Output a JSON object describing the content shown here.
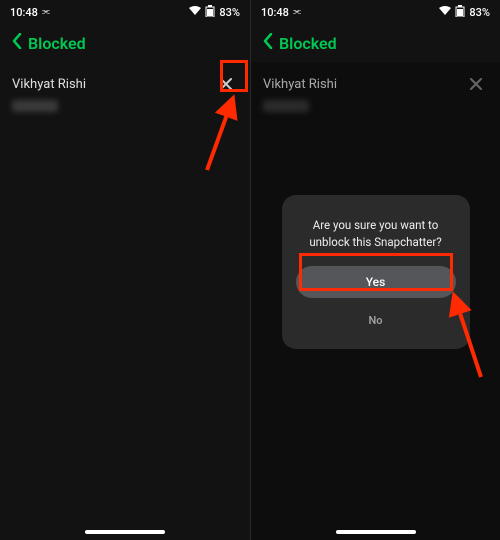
{
  "status": {
    "time": "10:48",
    "nfc_idle": "N",
    "battery_text": "83%"
  },
  "nav": {
    "title": "Blocked"
  },
  "list": {
    "entry_name": "Vikhyat Rishi"
  },
  "dialog": {
    "line1": "Are you sure you want to",
    "line2": "unblock this Snapchatter?",
    "yes": "Yes",
    "no": "No"
  },
  "annotation_color": "#ff2a00"
}
